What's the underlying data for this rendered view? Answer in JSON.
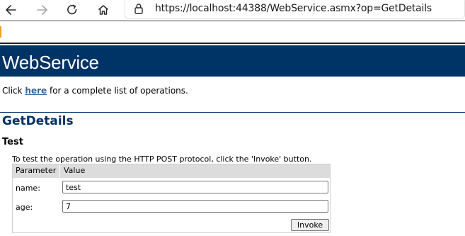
{
  "browser": {
    "url": "https://localhost:44388/WebService.asmx?op=GetDetails",
    "icons": {
      "back": "back-arrow-icon",
      "forward": "forward-arrow-icon",
      "refresh": "refresh-icon",
      "home": "home-icon",
      "lock": "lock-icon"
    }
  },
  "page": {
    "heading": "WebService",
    "intro_prefix": "Click ",
    "intro_link": "here",
    "intro_suffix": " for a complete list of operations.",
    "operation_title": "GetDetails",
    "test_title": "Test",
    "instructions": "To test the operation using the HTTP POST protocol, click the 'Invoke' button.",
    "table": {
      "headers": [
        "Parameter",
        "Value"
      ],
      "rows": [
        {
          "label": "name:",
          "value": "test"
        },
        {
          "label": "age:",
          "value": "7"
        }
      ],
      "invoke_label": "Invoke"
    }
  },
  "colors": {
    "heading_bg": "#003366",
    "link": "#336699",
    "table_header_bg": "#dcdcdc"
  }
}
